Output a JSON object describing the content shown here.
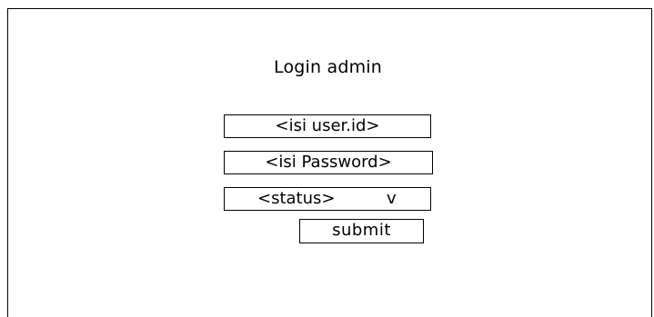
{
  "form": {
    "title": "Login admin",
    "userid_placeholder": "<isi  user.id>",
    "password_placeholder": "<isi Password>",
    "status_placeholder": "<status>",
    "status_chevron": "v",
    "submit_label": "submit"
  }
}
